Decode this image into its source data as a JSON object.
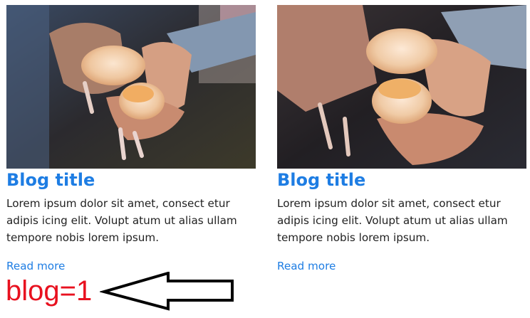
{
  "posts": [
    {
      "title": "Blog title",
      "excerpt": "Lorem ipsum dolor sit amet, consect etur adipis icing elit. Volupt atum ut alias ullam tempore nobis lorem ipsum.",
      "read_more": "Read more",
      "image_icon": "kittens-photo"
    },
    {
      "title": "Blog title",
      "excerpt": "Lorem ipsum dolor sit amet, consect etur adipis icing elit. Volupt atum ut alias ullam tempore nobis lorem ipsum.",
      "read_more": "Read more",
      "image_icon": "kittens-photo"
    }
  ],
  "annotation": {
    "label": "blog=1",
    "label_color": "#e8111f",
    "arrow_icon": "left-arrow-outline"
  },
  "colors": {
    "link": "#1e7de3",
    "text": "#222222"
  }
}
